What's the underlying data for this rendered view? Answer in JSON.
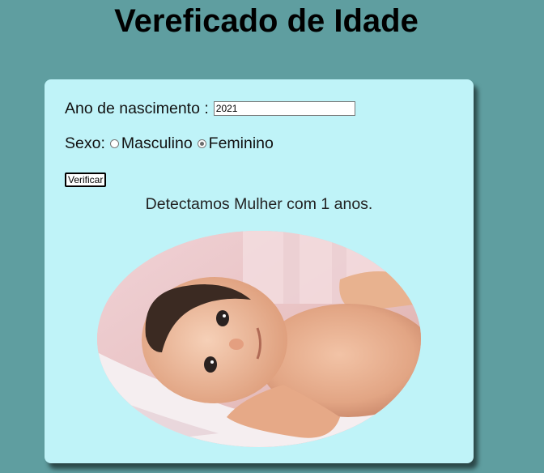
{
  "header": {
    "title": "Vereficado de Idade"
  },
  "form": {
    "year_label": "Ano de nascimento :",
    "year_value": "2021",
    "sex_label": "Sexo:",
    "sex_options": [
      {
        "label": "Masculino",
        "checked": false
      },
      {
        "label": "Feminino",
        "checked": true
      }
    ],
    "verify_button_label": "Verificar"
  },
  "result": {
    "text": "Detectamos Mulher com 1 anos."
  },
  "colors": {
    "background": "#5f9ea0",
    "card": "#bff3f8"
  }
}
